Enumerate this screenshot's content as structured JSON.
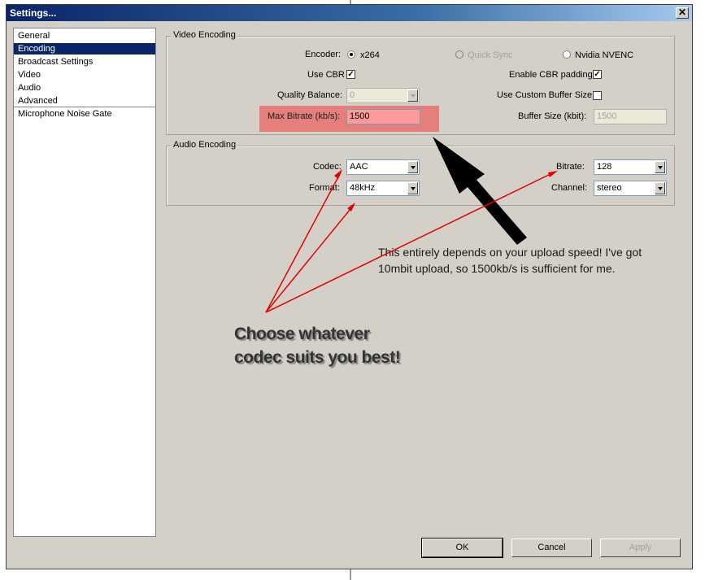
{
  "window": {
    "title": "Settings...",
    "close_glyph": "✕"
  },
  "sidebar": {
    "items": [
      {
        "label": "General"
      },
      {
        "label": "Encoding"
      },
      {
        "label": "Broadcast Settings"
      },
      {
        "label": "Video"
      },
      {
        "label": "Audio"
      },
      {
        "label": "Advanced"
      },
      {
        "label": "Microphone Noise Gate"
      }
    ],
    "selected": "Encoding"
  },
  "video_encoding": {
    "group_label": "Video Encoding",
    "encoder_label": "Encoder:",
    "encoder_options": [
      "x264",
      "Quick Sync",
      "Nvidia NVENC"
    ],
    "use_cbr_label": "Use CBR",
    "enable_cbr_padding_label": "Enable CBR padding",
    "quality_balance_label": "Quality Balance:",
    "quality_balance_value": "0",
    "use_custom_buffer_label": "Use Custom Buffer Size",
    "max_bitrate_label": "Max Bitrate (kb/s):",
    "max_bitrate_value": "1500",
    "buffer_size_label": "Buffer Size (kbit):",
    "buffer_size_value": "1500"
  },
  "audio_encoding": {
    "group_label": "Audio Encoding",
    "codec_label": "Codec:",
    "codec_value": "AAC",
    "format_label": "Format:",
    "format_value": "48kHz",
    "bitrate_label": "Bitrate:",
    "bitrate_value": "128",
    "channel_label": "Channel:",
    "channel_value": "stereo"
  },
  "buttons": {
    "ok": "OK",
    "cancel": "Cancel",
    "apply": "Apply"
  },
  "annotations": {
    "upload_line1": "This entirely depends on your upload speed! I've got",
    "upload_line2": "10mbit upload, so 1500kb/s is sufficient for me.",
    "codec_line1": "Choose whatever",
    "codec_line2": "codec suits you best!"
  },
  "colors": {
    "title_start": "#0a246a",
    "title_end": "#a6caf0",
    "highlight": "#f03c3c",
    "arrow_red": "#e00000"
  }
}
